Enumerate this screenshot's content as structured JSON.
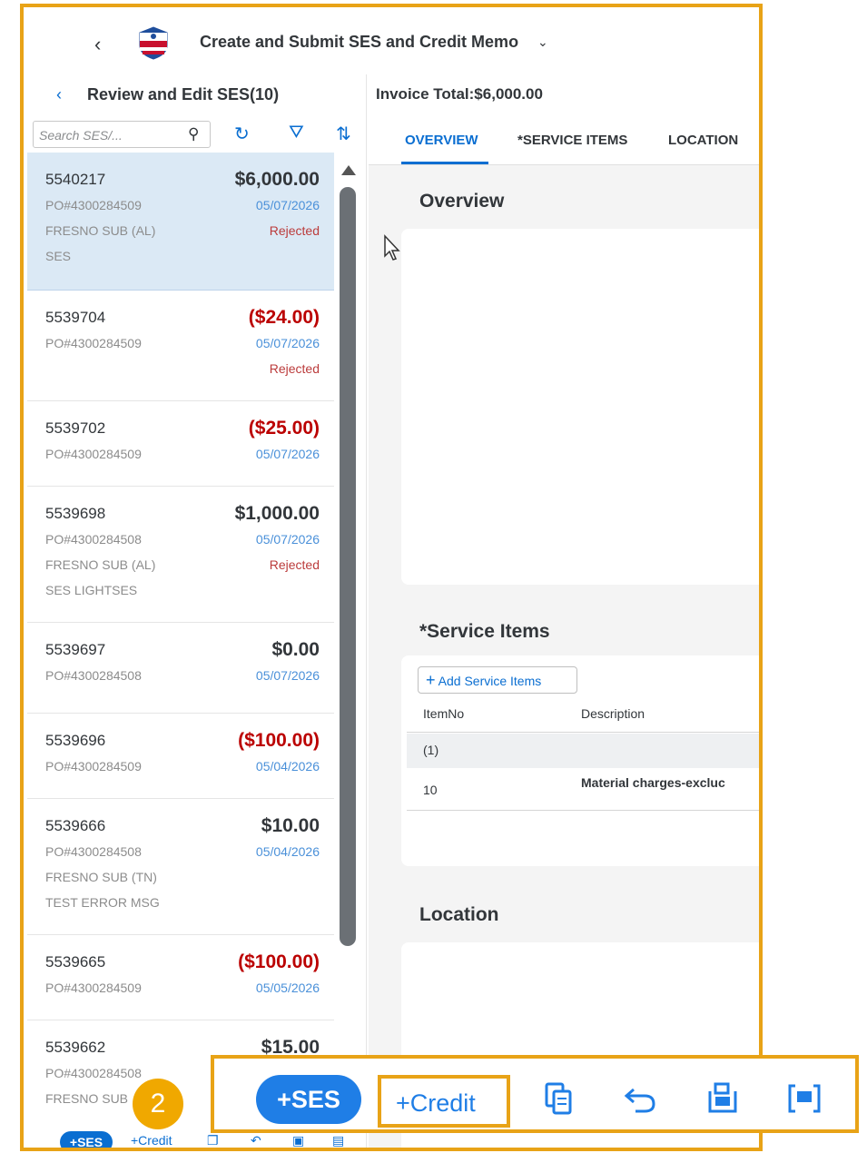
{
  "shell": {
    "title": "Create and Submit SES and Credit Memo",
    "chevron": "⌄"
  },
  "left": {
    "header_title": "Review and Edit SES(10)",
    "search_placeholder": "Search SES/...",
    "items": [
      {
        "id": "5540217",
        "amount": "$6,000.00",
        "po": "PO#4300284509",
        "date": "05/07/2026",
        "line3": "FRESNO SUB (AL)",
        "status": "Rejected",
        "line4": "SES"
      },
      {
        "id": "5539704",
        "amount": "($24.00)",
        "po": "PO#4300284509",
        "date": "05/07/2026",
        "line3": "",
        "status": "Rejected",
        "line4": ""
      },
      {
        "id": "5539702",
        "amount": "($25.00)",
        "po": "PO#4300284509",
        "date": "05/07/2026",
        "line3": "",
        "status": "",
        "line4": ""
      },
      {
        "id": "5539698",
        "amount": "$1,000.00",
        "po": "PO#4300284508",
        "date": "05/07/2026",
        "line3": "FRESNO SUB (AL)",
        "status": "Rejected",
        "line4": "SES LIGHTSES"
      },
      {
        "id": "5539697",
        "amount": "$0.00",
        "po": "PO#4300284508",
        "date": "05/07/2026",
        "line3": "",
        "status": "",
        "line4": ""
      },
      {
        "id": "5539696",
        "amount": "($100.00)",
        "po": "PO#4300284509",
        "date": "05/04/2026",
        "line3": "",
        "status": "",
        "line4": ""
      },
      {
        "id": "5539666",
        "amount": "$10.00",
        "po": "PO#4300284508",
        "date": "05/04/2026",
        "line3": "FRESNO SUB (TN)",
        "status": "",
        "line4": "TEST ERROR MSG"
      },
      {
        "id": "5539665",
        "amount": "($100.00)",
        "po": "PO#4300284509",
        "date": "05/05/2026",
        "line3": "",
        "status": "",
        "line4": ""
      },
      {
        "id": "5539662",
        "amount": "$15.00",
        "po": "PO#4300284508",
        "date": "",
        "line3": "FRESNO SUB",
        "status": "",
        "line4": ""
      }
    ],
    "footer": {
      "ses_label": "+SES",
      "credit_label": "+Credit"
    }
  },
  "right": {
    "invoice_total": "Invoice Total:$6,000.00",
    "tabs": [
      "OVERVIEW",
      "*SERVICE ITEMS",
      "LOCATION"
    ],
    "overview_title": "Overview",
    "service_items_title": "*Service Items",
    "add_service_label": "Add Service Items",
    "columns": [
      "ItemNo",
      "Description"
    ],
    "group_label": "(1)",
    "row": {
      "item_no": "10",
      "description": "Material charges-excluc"
    },
    "location_title": "Location"
  },
  "toolbar": {
    "ses_label": "+SES",
    "credit_label": "+Credit"
  },
  "badge": "2",
  "colors": {
    "accent": "#0a6ed1",
    "highlight_frame": "#e8a317",
    "negative": "#bb0000",
    "selected_row": "#dbe9f5"
  },
  "icons": [
    "back-icon",
    "union-pacific-logo",
    "chevron-down-icon",
    "search-icon",
    "refresh-icon",
    "filter-icon",
    "sort-icon",
    "cursor-icon",
    "add-icon",
    "copy-icon",
    "undo-icon",
    "delete-icon",
    "comment-icon"
  ]
}
